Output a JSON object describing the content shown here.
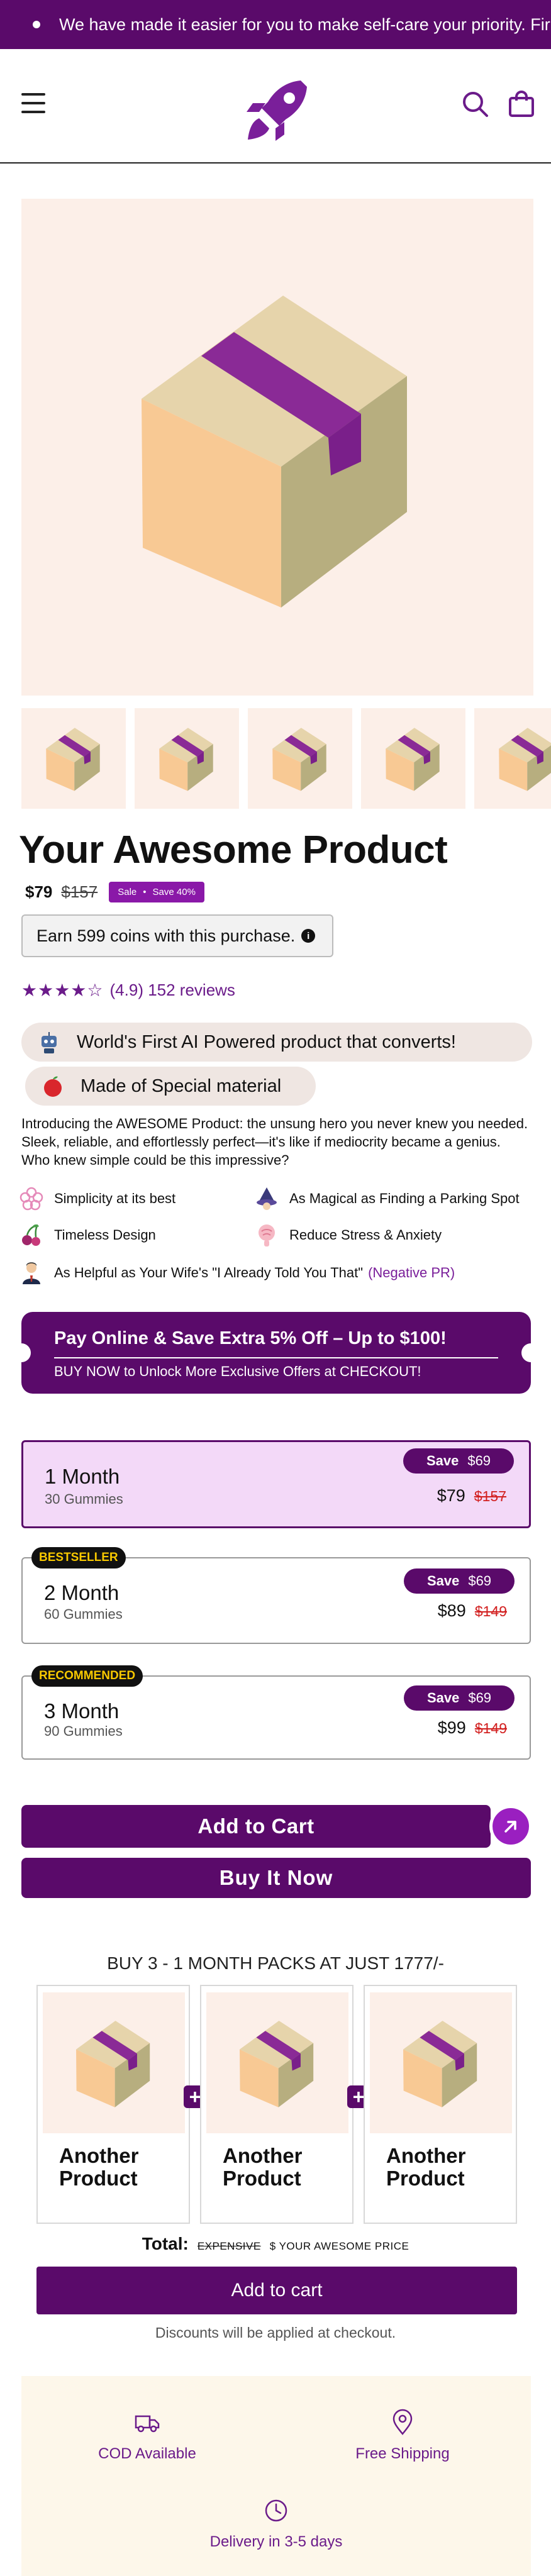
{
  "announcement": {
    "text": "We have made it easier for you to make self-care your priority. Fir"
  },
  "header": {
    "menu_icon": "hamburger-icon",
    "logo_icon": "rocket-logo-icon",
    "search_icon": "search-icon",
    "bag_icon": "shopping-bag-icon"
  },
  "product": {
    "title": "Your Awesome Product",
    "price": "$79",
    "compare_price": "$157",
    "sale_badge": {
      "label": "Sale",
      "save": "Save 40%"
    },
    "coins": "Earn 599 coins with this purchase.",
    "info_icon_glyph": "i",
    "rating_stars": "★★★★☆",
    "rating_value": 4.5,
    "rating_text": "(4.9) 152 reviews",
    "highlights": [
      {
        "icon": "robot-icon",
        "text": "World's First AI Powered product that converts!"
      },
      {
        "icon": "apple-icon",
        "text": "Made of Special material"
      }
    ],
    "description": "Introducing the AWESOME Product: the unsung hero you never knew you needed. Sleek, reliable, and effortlessly perfect—it's like if mediocrity became a genius. Who knew simple could be this impressive?",
    "features": [
      {
        "icon": "flower-icon",
        "text": "Simplicity at its best"
      },
      {
        "icon": "wizard-icon",
        "text": "As Magical as Finding a Parking Spot"
      },
      {
        "icon": "cherry-icon",
        "text": "Timeless Design"
      },
      {
        "icon": "brain-icon",
        "text": "Reduce Stress & Anxiety"
      },
      {
        "icon": "person-icon",
        "text": "As Helpful as Your Wife's \"I Already Told You That\"",
        "suffix": "(Negative PR)"
      }
    ]
  },
  "promo": {
    "title": "Pay Online & Save Extra 5% Off – Up to $100!",
    "subtitle": "BUY NOW to Unlock More Exclusive Offers at CHECKOUT!"
  },
  "packs": [
    {
      "name": "1 Month",
      "sub": "30 Gummies",
      "save_label": "Save",
      "save_amount": "$69",
      "price": "$79",
      "old_price": "$157",
      "tag": "",
      "selected": true
    },
    {
      "name": "2 Month",
      "sub": "60 Gummies",
      "save_label": "Save",
      "save_amount": "$69",
      "price": "$89",
      "old_price": "$149",
      "tag": "BESTSELLER",
      "selected": false
    },
    {
      "name": "3 Month",
      "sub": "90 Gummies",
      "save_label": "Save",
      "save_amount": "$69",
      "price": "$99",
      "old_price": "$149",
      "tag": "RECOMMENDED",
      "selected": false
    }
  ],
  "cta": {
    "add_to_cart": "Add to Cart",
    "buy_now": "Buy It Now",
    "arrow_icon": "arrow-up-right-icon"
  },
  "bundle": {
    "heading": "BUY 3 - 1 MONTH PACKS AT JUST 1777/-",
    "items": [
      "Another Product",
      "Another Product",
      "Another Product"
    ],
    "plus_glyph": "+",
    "total_label": "Total:",
    "total_strike": "EXPENSIVE",
    "total_price": "$ YOUR AWESOME PRICE",
    "add_label": "Add to cart",
    "discount_note": "Discounts will be applied at checkout."
  },
  "perks": [
    {
      "icon": "truck-icon",
      "text": "COD Available"
    },
    {
      "icon": "location-pin-icon",
      "text": "Free Shipping"
    },
    {
      "icon": "clock-icon",
      "text": "Delivery in 3-5 days"
    }
  ],
  "colors": {
    "brand": "#5a0a6a",
    "accent": "#8a18a8",
    "selected_bg": "#f3d9f8",
    "strike_red": "#d21f1f"
  }
}
